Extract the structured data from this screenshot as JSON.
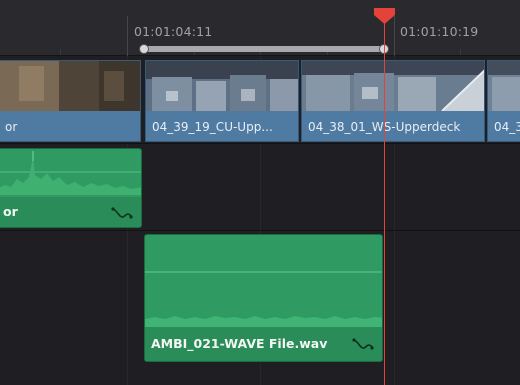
{
  "ruler": {
    "timecode_left": "01:01:04:11",
    "timecode_right": "01:01:10:19"
  },
  "video_track": {
    "clips": [
      {
        "label": "or"
      },
      {
        "label": "04_39_19_CU-Upp..."
      },
      {
        "label": "04_38_01_WS-Upperdeck"
      },
      {
        "label": "04_3"
      }
    ]
  },
  "audio_track_1": {
    "clips": [
      {
        "label": "or"
      }
    ]
  },
  "audio_track_2": {
    "clips": [
      {
        "label": "AMBI_021-WAVE File.wav"
      }
    ]
  },
  "colors": {
    "background": "#1f1f23",
    "ruler": "#2a2a2e",
    "video_clip": "#5a86ad",
    "audio_clip": "#2f9a62",
    "playhead": "#e5423a"
  },
  "icons": {
    "playhead": "playhead-marker-icon",
    "audio_fx": "audio-curve-icon"
  }
}
